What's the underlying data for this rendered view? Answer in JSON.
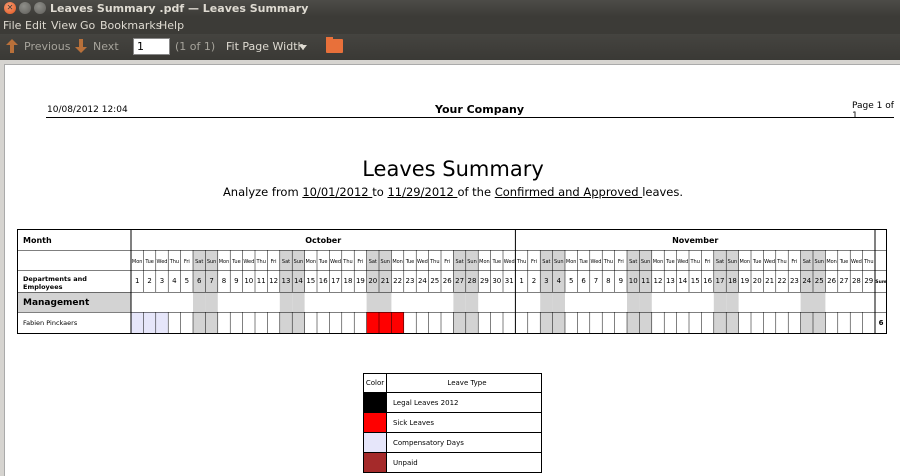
{
  "window": {
    "title": "Leaves Summary .pdf — Leaves Summary"
  },
  "menu": [
    "File",
    "Edit",
    "View",
    "Go",
    "Bookmarks",
    "Help"
  ],
  "toolbar": {
    "previous_label": "Previous",
    "next_label": "Next",
    "page_value": "1",
    "page_count": "(1 of 1)",
    "zoom_label": "Fit Page Width"
  },
  "doc": {
    "date": "10/08/2012 12:04",
    "company": "Your Company",
    "page": "Page 1 of 1",
    "title": "Leaves Summary",
    "analyze_prefix": "Analyze from ",
    "from_date": "10/01/2012 ",
    "to_word": "to ",
    "to_date": "11/29/2012 ",
    "of_the": "of the ",
    "state": "Confirmed and Approved ",
    "suffix": "leaves."
  },
  "calendar": {
    "month_header": "Month",
    "dept_header_line1": "Departments and",
    "dept_header_line2": "Employees",
    "months": [
      {
        "name": "October",
        "days": 31,
        "first_weekday": 0
      },
      {
        "name": "November",
        "days": 29,
        "first_weekday": 3
      }
    ],
    "weekday_abbr": [
      "Mon",
      "Tue",
      "Wed",
      "Thu",
      "Fri",
      "Sat",
      "Sun"
    ],
    "sum_label": "Sum",
    "department": "Management",
    "employees": [
      {
        "name": "Fabien Pinckaers",
        "total": "6",
        "leaves": [
          {
            "month": 0,
            "day": 1,
            "type": 2
          },
          {
            "month": 0,
            "day": 2,
            "type": 2
          },
          {
            "month": 0,
            "day": 3,
            "type": 2
          },
          {
            "month": 0,
            "day": 20,
            "type": 1
          },
          {
            "month": 0,
            "day": 21,
            "type": 1
          },
          {
            "month": 0,
            "day": 22,
            "type": 1
          }
        ]
      }
    ],
    "weekend_color": "#d3d3d3"
  },
  "legend": {
    "col_color": "Color",
    "col_type": "Leave Type",
    "items": [
      {
        "label": "Legal Leaves 2012",
        "color": "#000000"
      },
      {
        "label": "Sick Leaves",
        "color": "#ff0000"
      },
      {
        "label": "Compensatory Days",
        "color": "#e6e6fa"
      },
      {
        "label": "Unpaid",
        "color": "#a52a2a"
      }
    ]
  }
}
